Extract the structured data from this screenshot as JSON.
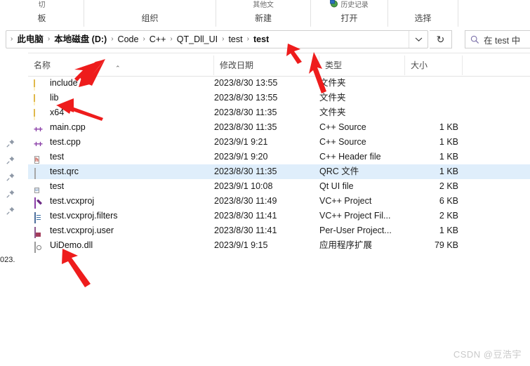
{
  "ribbon": {
    "groups": [
      {
        "label": "板",
        "hint": "切"
      },
      {
        "label": "组织",
        "hint": ""
      },
      {
        "label": "新建",
        "hint": "其他文"
      },
      {
        "label": "打开",
        "hint": "历史记录"
      },
      {
        "label": "选择",
        "hint": ""
      }
    ]
  },
  "address": {
    "crumbs": [
      {
        "text": "此电脑",
        "bold": true
      },
      {
        "text": "本地磁盘 (D:)",
        "bold": true
      },
      {
        "text": "Code",
        "bold": false
      },
      {
        "text": "C++",
        "bold": false
      },
      {
        "text": "QT_Dll_UI",
        "bold": false
      },
      {
        "text": "test",
        "bold": false
      },
      {
        "text": "test",
        "bold": true
      }
    ],
    "separator": "›",
    "dropdown_icon": "chevron-down-icon",
    "refresh_icon": "refresh-icon",
    "refresh_glyph": "↻"
  },
  "search": {
    "icon": "search-icon",
    "placeholder": "在 test 中"
  },
  "nav": {
    "pin_icon": "pin-icon",
    "pin_count": 5,
    "fragment_text": "023."
  },
  "columns": {
    "name": "名称",
    "date": "修改日期",
    "type": "类型",
    "size": "大小",
    "sort_caret": "⌃"
  },
  "files": [
    {
      "name": "include",
      "icon": "folder-icon",
      "date": "2023/8/30 13:55",
      "type": "文件夹",
      "size": "",
      "selected": false
    },
    {
      "name": "lib",
      "icon": "folder-icon",
      "date": "2023/8/30 13:55",
      "type": "文件夹",
      "size": "",
      "selected": false
    },
    {
      "name": "x64",
      "icon": "folder-icon",
      "date": "2023/8/30 11:35",
      "type": "文件夹",
      "size": "",
      "selected": false
    },
    {
      "name": "main.cpp",
      "icon": "cpp-source-icon",
      "date": "2023/8/30 11:35",
      "type": "C++ Source",
      "size": "1 KB",
      "selected": false
    },
    {
      "name": "test.cpp",
      "icon": "cpp-source-icon",
      "date": "2023/9/1 9:21",
      "type": "C++ Source",
      "size": "1 KB",
      "selected": false
    },
    {
      "name": "test",
      "icon": "cpp-header-icon",
      "date": "2023/9/1 9:20",
      "type": "C++ Header file",
      "size": "1 KB",
      "selected": false
    },
    {
      "name": "test.qrc",
      "icon": "qrc-file-icon",
      "date": "2023/8/30 11:35",
      "type": "QRC 文件",
      "size": "1 KB",
      "selected": true
    },
    {
      "name": "test",
      "icon": "qt-ui-file-icon",
      "date": "2023/9/1 10:08",
      "type": "Qt UI file",
      "size": "2 KB",
      "selected": false
    },
    {
      "name": "test.vcxproj",
      "icon": "vcxproj-icon",
      "date": "2023/8/30 11:49",
      "type": "VC++ Project",
      "size": "6 KB",
      "selected": false
    },
    {
      "name": "test.vcxproj.filters",
      "icon": "vcxproj-filters-icon",
      "date": "2023/8/30 11:41",
      "type": "VC++ Project Fil...",
      "size": "2 KB",
      "selected": false
    },
    {
      "name": "test.vcxproj.user",
      "icon": "vcxproj-user-icon",
      "date": "2023/8/30 11:41",
      "type": "Per-User Project...",
      "size": "1 KB",
      "selected": false
    },
    {
      "name": "UiDemo.dll",
      "icon": "dll-file-icon",
      "date": "2023/9/1 9:15",
      "type": "应用程序扩展",
      "size": "79 KB",
      "selected": false
    }
  ],
  "annotations": {
    "color": "#ee1c1c",
    "arrows": [
      {
        "name": "arrow-to-include-folder"
      },
      {
        "name": "arrow-to-lib-folder"
      },
      {
        "name": "arrow-to-type-column"
      },
      {
        "name": "arrow-to-breadcrumb-test"
      },
      {
        "name": "arrow-to-uidemo-dll"
      }
    ]
  },
  "watermark": {
    "text": "CSDN @豆浩宇"
  }
}
